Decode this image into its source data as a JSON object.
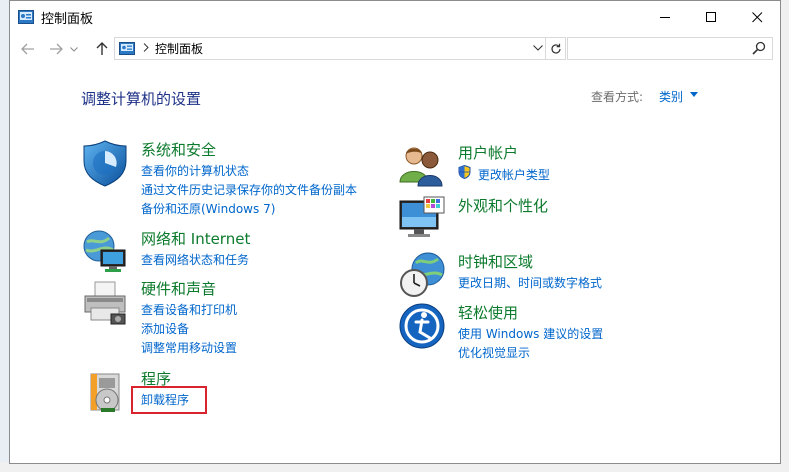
{
  "window": {
    "title": "控制面板",
    "controls": {
      "minimize": "—",
      "maximize": "☐",
      "close": "✕"
    }
  },
  "address": {
    "crumb": "控制面板",
    "search_placeholder": ""
  },
  "content": {
    "heading": "调整计算机的设置",
    "view_by_label": "查看方式:",
    "view_by_value": "类别"
  },
  "categories": {
    "system": {
      "title": "系统和安全",
      "links": [
        "查看你的计算机状态",
        "通过文件历史记录保存你的文件备份副本",
        "备份和还原(Windows 7)"
      ],
      "icon": "shield-icon"
    },
    "network": {
      "title": "网络和 Internet",
      "links": [
        "查看网络状态和任务"
      ],
      "icon": "network-globe-icon"
    },
    "hardware": {
      "title": "硬件和声音",
      "links": [
        "查看设备和打印机",
        "添加设备",
        "调整常用移动设置"
      ],
      "icon": "printer-icon"
    },
    "programs": {
      "title": "程序",
      "links": [
        "卸载程序"
      ],
      "icon": "programs-disc-icon"
    },
    "users": {
      "title": "用户帐户",
      "links": [
        "更改帐户类型"
      ],
      "icon": "users-icon"
    },
    "appearance": {
      "title": "外观和个性化",
      "links": [],
      "icon": "monitor-palette-icon"
    },
    "clock": {
      "title": "时钟和区域",
      "links": [
        "更改日期、时间或数字格式"
      ],
      "icon": "clock-globe-icon"
    },
    "ease": {
      "title": "轻松使用",
      "links": [
        "使用 Windows 建议的设置",
        "优化视觉显示"
      ],
      "icon": "ease-of-access-icon"
    }
  },
  "colors": {
    "heading": "#1e3287",
    "category_title": "#0c7a2c",
    "link": "#0066cc",
    "highlight": "#d9232d"
  }
}
